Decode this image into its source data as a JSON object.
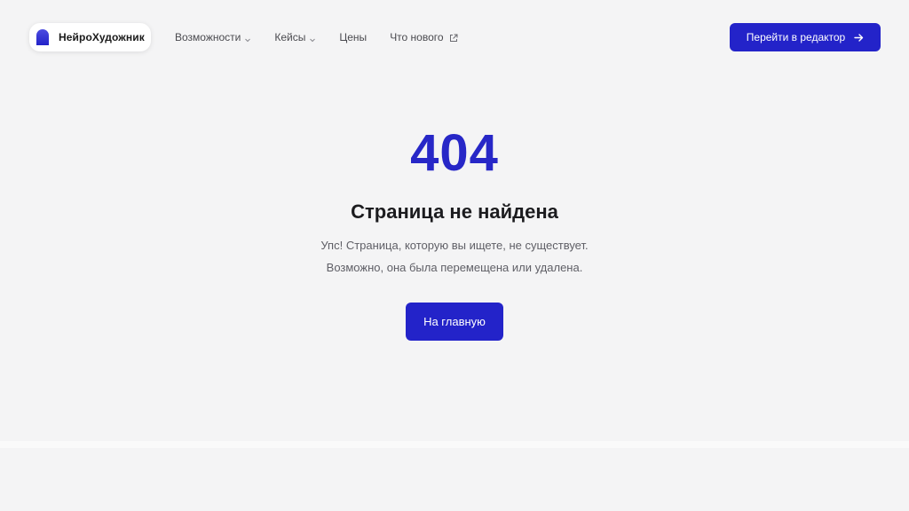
{
  "brand": {
    "name": "НейроХудожник",
    "logo_icon": "arch-logo-icon",
    "accent_color": "#2323c9"
  },
  "nav": {
    "items": [
      {
        "label": "Возможности",
        "icon": "chevron-down-icon"
      },
      {
        "label": "Кейсы",
        "icon": "chevron-down-icon"
      },
      {
        "label": "Цены",
        "icon": ""
      },
      {
        "label": "Что нового",
        "icon": "external-link-icon"
      }
    ]
  },
  "header": {
    "editor_button_label": "Перейти в редактор",
    "editor_button_icon": "arrow-right-icon"
  },
  "error": {
    "code": "404",
    "title": "Страница не найдена",
    "line1": "Упс! Страница, которую вы ищете, не существует.",
    "line2": "Возможно, она была перемещена или удалена.",
    "home_button_label": "На главную"
  }
}
